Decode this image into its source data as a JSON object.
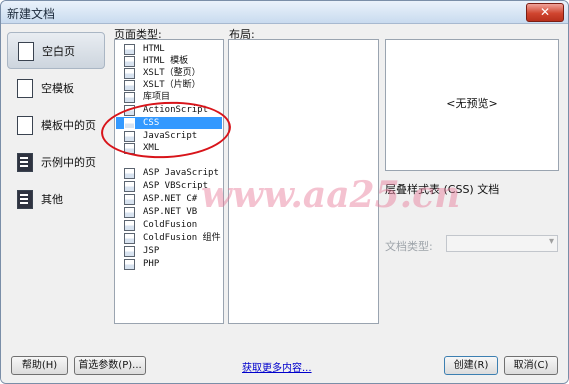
{
  "window": {
    "title": "新建文档",
    "close_glyph": "✕"
  },
  "sidebar": {
    "items": [
      {
        "label": "空白页",
        "icon": "blank-page-icon",
        "selected": true
      },
      {
        "label": "空模板",
        "icon": "blank-template-icon"
      },
      {
        "label": "模板中的页",
        "icon": "template-page-icon"
      },
      {
        "label": "示例中的页",
        "icon": "sample-page-icon"
      },
      {
        "label": "其他",
        "icon": "other-icon"
      }
    ]
  },
  "page_type": {
    "label": "页面类型:",
    "items": [
      "HTML",
      "HTML 模板",
      "XSLT（整页）",
      "XSLT（片断）",
      "库项目",
      "ActionScript",
      "CSS",
      "JavaScript",
      "XML",
      "ASP JavaScript",
      "ASP VBScript",
      "ASP.NET C#",
      "ASP.NET VB",
      "ColdFusion",
      "ColdFusion 组件",
      "JSP",
      "PHP"
    ],
    "selected": "CSS"
  },
  "layout": {
    "label": "布局:"
  },
  "preview": {
    "text": "<无预览>"
  },
  "description": "层叠样式表 (CSS) 文档",
  "doctype": {
    "label": "文档类型:",
    "value": ""
  },
  "footer": {
    "help": "帮助(H)",
    "prefs": "首选参数(P)...",
    "more": "获取更多内容...",
    "create": "创建(R)",
    "cancel": "取消(C)"
  },
  "watermark": "www.aa25.cn",
  "colors": {
    "selection": "#3399ff",
    "annotation": "#d8141a",
    "link": "#0000cc"
  }
}
